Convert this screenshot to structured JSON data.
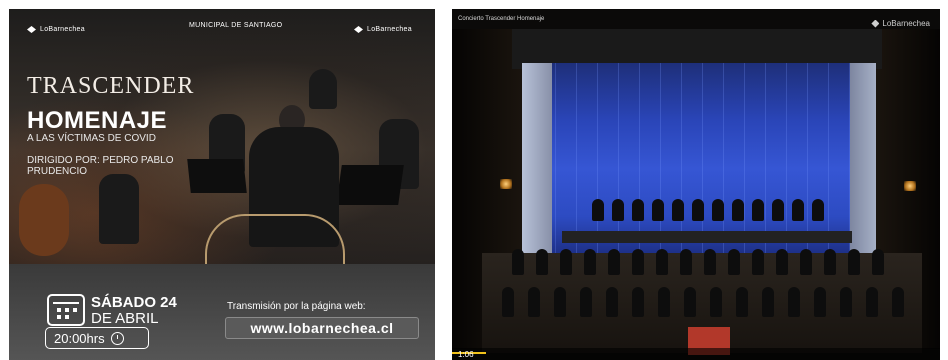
{
  "poster": {
    "logo_left": "LoBarnechea",
    "logo_center": "MUNICIPAL DE SANTIAGO",
    "logo_right": "LoBarnechea",
    "title_line1": "TRASCENDER",
    "title_line2": "HOMENAJE",
    "title_line3": "A LAS VÍCTIMAS DE COVID",
    "director": "DIRIGIDO POR: PEDRO PABLO PRUDENCIO",
    "date_day": "SÁBADO 24",
    "date_month": "DE ABRIL",
    "time": "20:00hrs",
    "stream_label": "Transmisión por la página web:",
    "url": "www.lobarnechea.cl"
  },
  "video": {
    "title": "Concierto Trascender Homenaje",
    "logo": "LoBarnechea",
    "progress": 0.02,
    "progress_color": "#f1c21b",
    "timestamp": "1:06"
  }
}
